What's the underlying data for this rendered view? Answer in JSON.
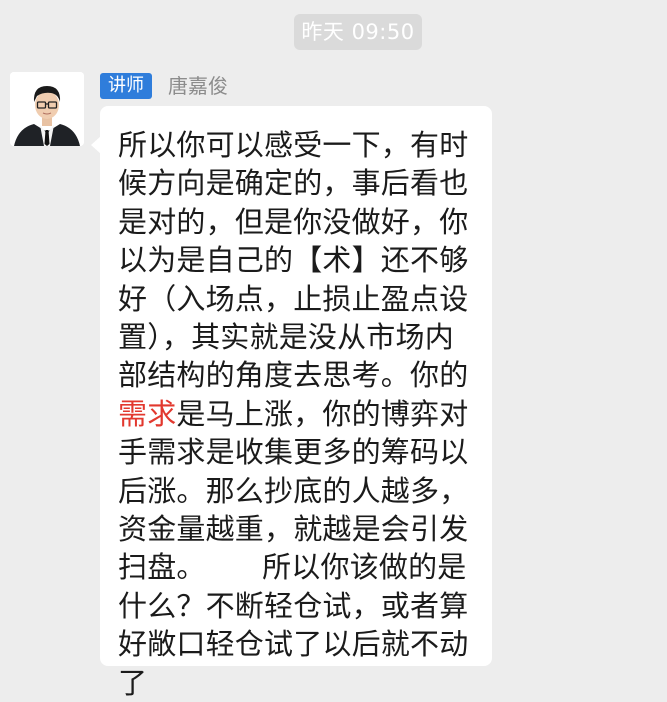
{
  "timestamp": "昨天 09:50",
  "sender": {
    "role_badge": "讲师",
    "name": "唐嘉俊",
    "avatar_icon": "person-avatar"
  },
  "message": {
    "lines_before": "所以你可以感受一下，有时\n候方向是确定的，事后看也\n是对的，但是你没做好，你\n以为是自己的【术】还不够\n好（入场点，止损止盈点设\n置），其实就是没从市场内\n部结构的角度去思考。你的\n",
    "highlight": "需求",
    "lines_after": "是马上涨，你的博弈对\n手需求是收集更多的筹码以\n后涨。那么抄底的人越多，\n资金量越重，就越是会引发\n扫盘。      所以你该做的是\n什么？不断轻仓试，或者算\n好敞口轻仓试了以后就不动\n了"
  },
  "colors": {
    "background": "#ededed",
    "badge": "#2f7ddb",
    "highlight": "#e2382e"
  }
}
